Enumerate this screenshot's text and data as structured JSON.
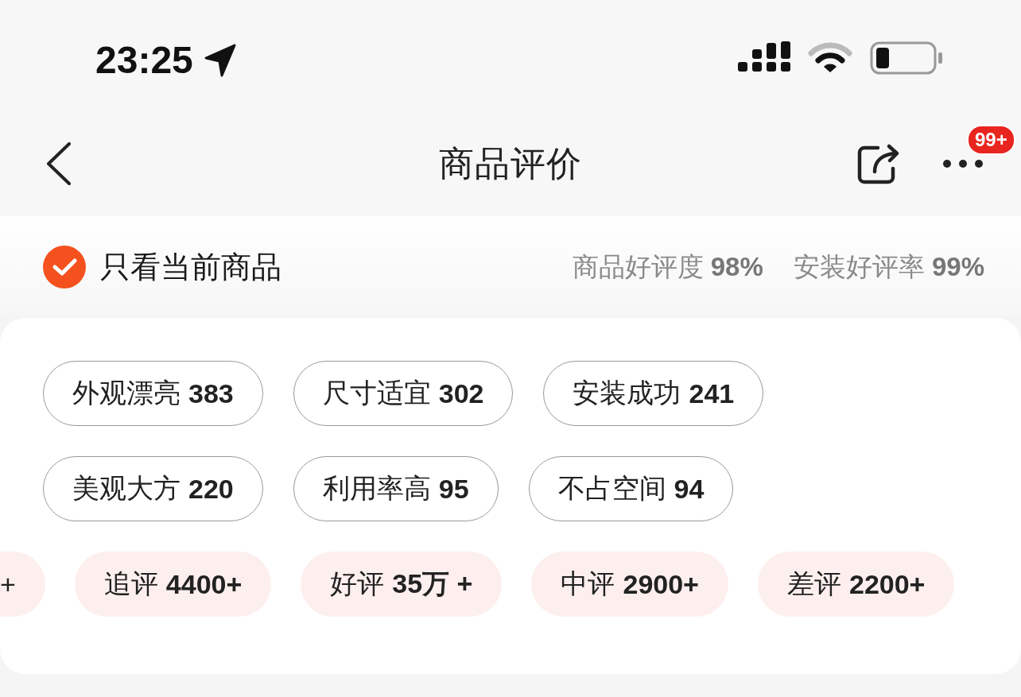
{
  "status_bar": {
    "time": "23:25"
  },
  "nav_bar": {
    "title": "商品评价",
    "more_badge": "99+"
  },
  "filter_bar": {
    "only_current": {
      "label": "只看当前商品",
      "checked": true
    },
    "ratings": [
      {
        "label": "商品好评度",
        "value": "98%"
      },
      {
        "label": "安装好评率",
        "value": "99%"
      }
    ]
  },
  "review_card": {
    "tags": [
      {
        "label": "外观漂亮",
        "count": "383"
      },
      {
        "label": "尺寸适宜",
        "count": "302"
      },
      {
        "label": "安装成功",
        "count": "241"
      },
      {
        "label": "美观大方",
        "count": "220"
      },
      {
        "label": "利用率高",
        "count": "95"
      },
      {
        "label": "不占空间",
        "count": "94"
      }
    ],
    "filters": [
      {
        "count": "+"
      },
      {
        "label": "追评",
        "count": "4400+"
      },
      {
        "label": "好评",
        "count": "35万 +"
      },
      {
        "label": "中评",
        "count": "2900+"
      },
      {
        "label": "差评",
        "count": "2200+"
      }
    ]
  }
}
